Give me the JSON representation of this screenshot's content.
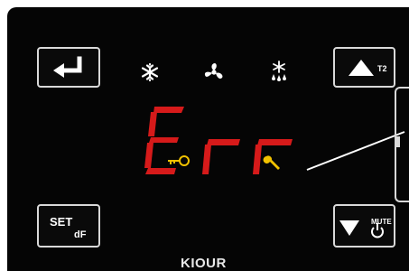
{
  "display": {
    "text": "Err",
    "segment_color": "#d61a1a",
    "icon_color": "#f2c200"
  },
  "buttons": {
    "set_label": "SET",
    "df_label": "dF",
    "t2_label": "T2",
    "mute_label": "MUTE"
  },
  "indicators": [
    "snowflake-icon",
    "fan-icon",
    "defrost-icon",
    "key-icon",
    "wrench-icon"
  ],
  "brand": "KIOUR",
  "colors": {
    "panel": "#050505",
    "button_border": "#d9d9d9",
    "label": "#ffffff"
  }
}
